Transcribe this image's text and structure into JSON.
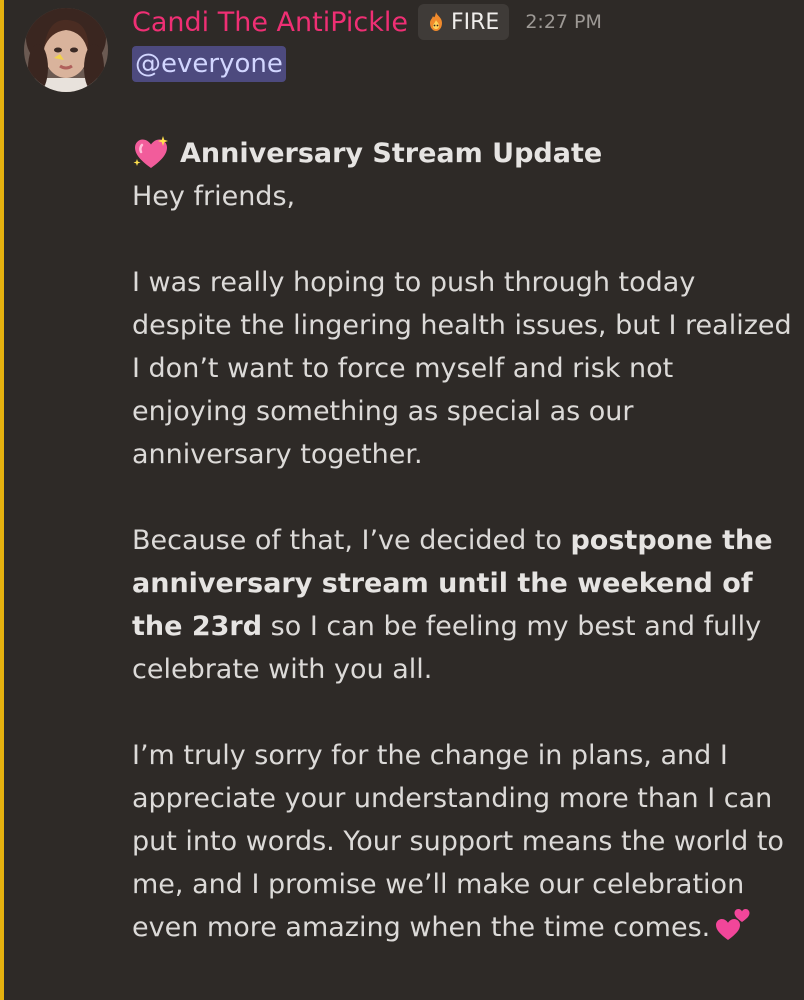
{
  "message": {
    "author": "Candi The AntiPickle",
    "role_tag": {
      "icon": "fire-cat-icon",
      "label": "FIRE"
    },
    "timestamp": "2:27 PM",
    "mention": "@everyone",
    "heading": {
      "emoji": "sparkling-heart-icon",
      "text": "Anniversary Stream Update"
    },
    "greeting": "Hey friends,",
    "paragraph_1": "I was really hoping to push through today despite the lingering health issues, but I realized I don’t want to force myself and risk not enjoying something as special as our anniversary together.",
    "paragraph_2": {
      "before": "Because of that, I’ve decided to ",
      "bold": "postpone the anniversary stream until the weekend of the 23rd",
      "after": " so I can be feeling my best and fully celebrate with you all."
    },
    "paragraph_3": {
      "text": "I’m truly sorry for the change in plans, and I appreciate your understanding more than I can put into words. Your support means the world to me, and I promise we’ll make our celebration even more amazing when the time comes.",
      "emoji": "two-hearts-icon"
    }
  },
  "colors": {
    "background": "#2e2a27",
    "mention_bar": "#e5b10f",
    "username": "#ef2f74",
    "mention_bg": "#4d4a7e",
    "mention_text": "#d2d6ff",
    "body_text": "#dcdad8"
  }
}
